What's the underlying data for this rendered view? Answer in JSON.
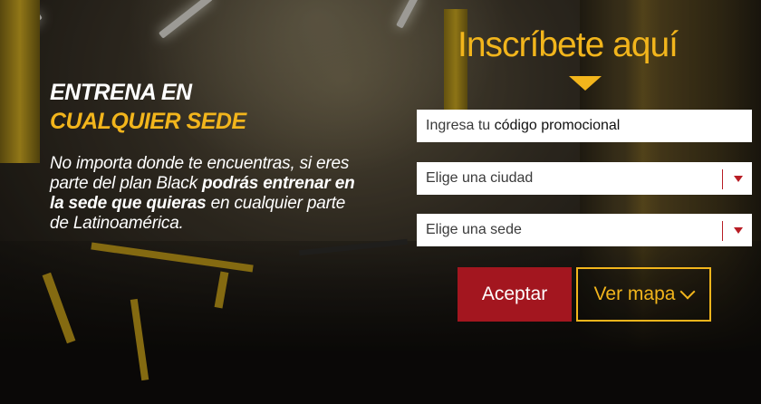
{
  "left": {
    "headline_line1": "ENTRENA EN",
    "headline_word1": "CUALQUIER",
    "headline_word2": "SEDE",
    "desc_part1": "No importa donde te encuentras, si eres parte del plan Black ",
    "desc_bold": "podrás entrenar en la sede que quieras",
    "desc_part2": " en cualquier parte de Latinoamérica."
  },
  "form": {
    "title": "Inscríbete aquí",
    "promo_prefix": "Ingresa tu ",
    "promo_strong": "código promocional",
    "city_select": "Elige una ciudad",
    "sede_select": "Elige una sede",
    "accept_label": "Aceptar",
    "map_label": "Ver mapa"
  },
  "colors": {
    "accent": "#f2b51c",
    "button_red": "#a3161f",
    "caret_red": "#b81d25"
  },
  "icons": {
    "arrow": "triangle-down-icon",
    "select_caret": "caret-down-icon",
    "map_chevron": "chevron-down-icon"
  }
}
